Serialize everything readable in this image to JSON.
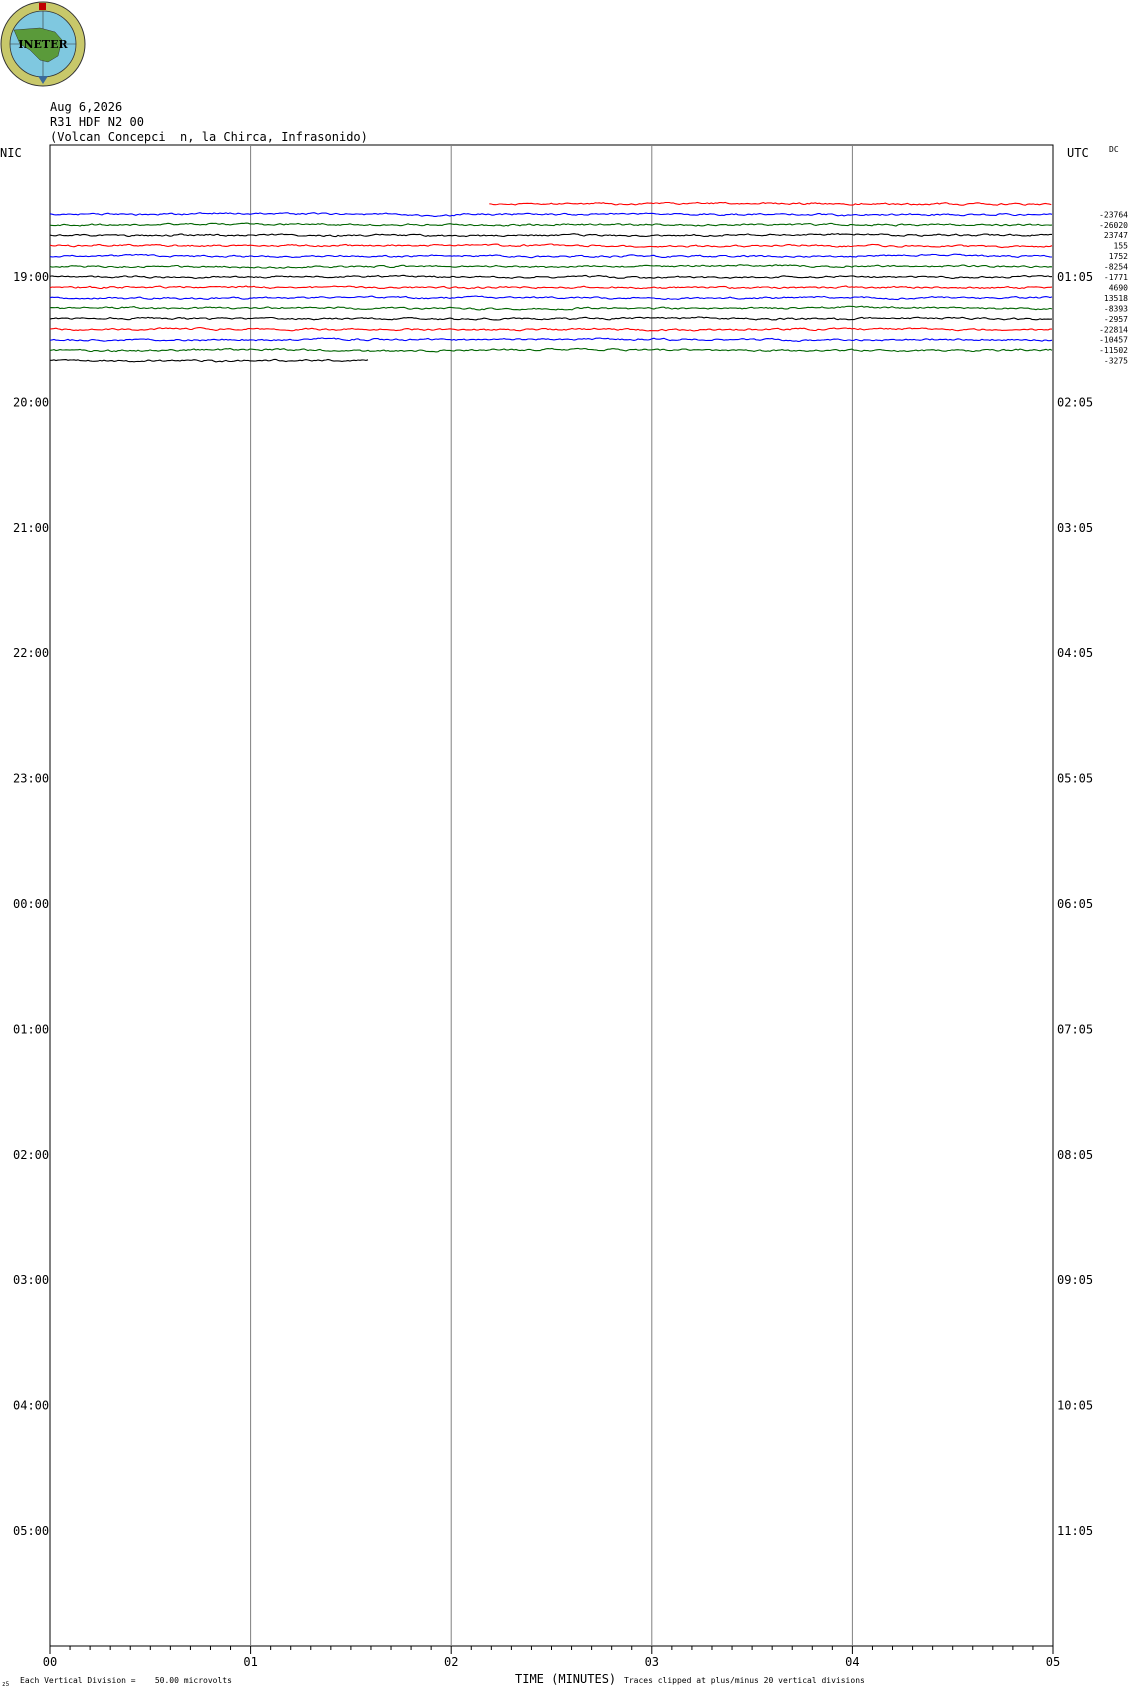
{
  "header": {
    "date": "Aug 6,2026",
    "station": "R31 HDF N2 00",
    "location": "(Volcan Concepci  n, la Chirca, Infrasonido)"
  },
  "logo": {
    "text": "INETER",
    "colors": {
      "ring": "#c8c86a",
      "globe": "#7fc8e0",
      "land": "#5a9a3a"
    }
  },
  "left_axis_title": "NIC",
  "right_axis_title": "UTC",
  "dc_title": "DC",
  "x_axis_title": "TIME (MINUTES)",
  "footer": {
    "scale_note": "Each Vertical Division =    50.00 microvolts",
    "clip_note": "Traces clipped at plus/minus 20 vertical divisions",
    "corner_mark": "z5"
  },
  "chart_data": {
    "type": "line",
    "title": "",
    "xlabel": "TIME (MINUTES)",
    "xlim": [
      0,
      5
    ],
    "x_ticks": [
      "00",
      "01",
      "02",
      "03",
      "04",
      "05"
    ],
    "left_time_labels": [
      "19:00",
      "20:00",
      "21:00",
      "22:00",
      "23:00",
      "00:00",
      "01:00",
      "02:00",
      "03:00",
      "04:00",
      "05:00"
    ],
    "right_time_labels": [
      "01:05",
      "02:05",
      "03:05",
      "04:05",
      "05:05",
      "06:05",
      "07:05",
      "08:05",
      "09:05",
      "10:05",
      "11:05"
    ],
    "rows_per_hour": 12,
    "first_row_offset_from_1900_row": -7,
    "trace_colors": [
      "#ff0000",
      "#0000ff",
      "#006400",
      "#000000"
    ],
    "traces": [
      {
        "row": 0,
        "color": "#ff0000",
        "start_min": 2.19,
        "end_min": 5.0,
        "dc": ""
      },
      {
        "row": 1,
        "color": "#0000ff",
        "start_min": 0.0,
        "end_min": 5.0,
        "dc": "-23764"
      },
      {
        "row": 2,
        "color": "#006400",
        "start_min": 0.0,
        "end_min": 5.0,
        "dc": "-26020"
      },
      {
        "row": 3,
        "color": "#000000",
        "start_min": 0.0,
        "end_min": 5.0,
        "dc": "23747"
      },
      {
        "row": 4,
        "color": "#ff0000",
        "start_min": 0.0,
        "end_min": 5.0,
        "dc": "155"
      },
      {
        "row": 5,
        "color": "#0000ff",
        "start_min": 0.0,
        "end_min": 5.0,
        "dc": "1752"
      },
      {
        "row": 6,
        "color": "#006400",
        "start_min": 0.0,
        "end_min": 5.0,
        "dc": "-8254"
      },
      {
        "row": 7,
        "color": "#000000",
        "start_min": 0.0,
        "end_min": 5.0,
        "dc": "-1771"
      },
      {
        "row": 8,
        "color": "#ff0000",
        "start_min": 0.0,
        "end_min": 5.0,
        "dc": "4690"
      },
      {
        "row": 9,
        "color": "#0000ff",
        "start_min": 0.0,
        "end_min": 5.0,
        "dc": "13518"
      },
      {
        "row": 10,
        "color": "#006400",
        "start_min": 0.0,
        "end_min": 5.0,
        "dc": "-8393"
      },
      {
        "row": 11,
        "color": "#000000",
        "start_min": 0.0,
        "end_min": 5.0,
        "dc": "-2957"
      },
      {
        "row": 12,
        "color": "#ff0000",
        "start_min": 0.0,
        "end_min": 5.0,
        "dc": "-22814"
      },
      {
        "row": 13,
        "color": "#0000ff",
        "start_min": 0.0,
        "end_min": 5.0,
        "dc": "-10457"
      },
      {
        "row": 14,
        "color": "#006400",
        "start_min": 0.0,
        "end_min": 5.0,
        "dc": "-11502"
      },
      {
        "row": 15,
        "color": "#000000",
        "start_min": 0.0,
        "end_min": 1.59,
        "dc": "-3275"
      }
    ]
  }
}
